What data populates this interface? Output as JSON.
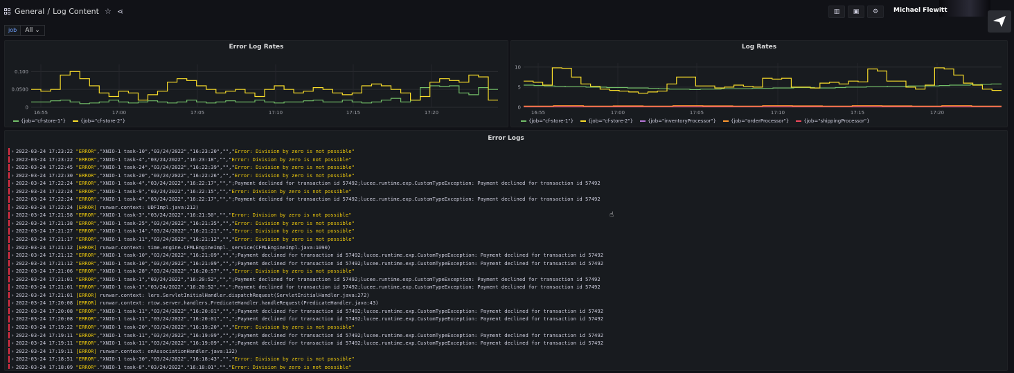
{
  "breadcrumb": {
    "folder": "General",
    "separator": "/",
    "dashboard": "Log Content"
  },
  "user": {
    "name": "Michael Flewitt"
  },
  "variables": [
    {
      "label": "job",
      "value": "All"
    }
  ],
  "colors": {
    "green": "#73bf69",
    "yellow": "#fade2a",
    "purple": "#b877d9",
    "orange": "#ff9830",
    "red": "#f2495c",
    "error_text": "#f2cc0c"
  },
  "panels": {
    "error_rates": {
      "title": "Error Log Rates"
    },
    "log_rates": {
      "title": "Log Rates"
    },
    "error_logs": {
      "title": "Error Logs"
    }
  },
  "chart_data": [
    {
      "type": "line",
      "title": "Error Log Rates",
      "x_ticks": [
        "16:55",
        "17:00",
        "17:05",
        "17:10",
        "17:15",
        "17:20"
      ],
      "y_ticks": [
        "0",
        "0.0500",
        "0.100"
      ],
      "ylim": [
        0,
        0.12
      ],
      "grid": true,
      "legend_position": "bottom-left",
      "series": [
        {
          "name": "{job=\"cf-store-1\"}",
          "color": "#73bf69",
          "values": [
            0.015,
            0.015,
            0.018,
            0.02,
            0.015,
            0.01,
            0.012,
            0.015,
            0.02,
            0.015,
            0.012,
            0.015,
            0.018,
            0.015,
            0.012,
            0.015,
            0.02,
            0.015,
            0.012,
            0.015,
            0.018,
            0.015,
            0.015,
            0.02,
            0.015,
            0.012,
            0.015,
            0.015,
            0.018,
            0.02,
            0.015,
            0.015,
            0.02,
            0.015,
            0.012,
            0.015,
            0.02,
            0.025,
            0.015,
            0.02,
            0.055,
            0.06,
            0.058,
            0.06,
            0.04,
            0.035,
            0.055,
            0.05
          ]
        },
        {
          "name": "{job=\"cf-store-2\"}",
          "color": "#fade2a",
          "values": [
            0.05,
            0.045,
            0.05,
            0.09,
            0.1,
            0.08,
            0.06,
            0.04,
            0.03,
            0.045,
            0.04,
            0.02,
            0.035,
            0.045,
            0.07,
            0.08,
            0.075,
            0.06,
            0.05,
            0.04,
            0.045,
            0.05,
            0.04,
            0.03,
            0.05,
            0.06,
            0.05,
            0.04,
            0.045,
            0.055,
            0.05,
            0.04,
            0.035,
            0.04,
            0.06,
            0.065,
            0.06,
            0.05,
            0.04,
            0.02,
            0.03,
            0.07,
            0.08,
            0.075,
            0.07,
            0.09,
            0.085,
            0.02
          ]
        }
      ]
    },
    {
      "type": "line",
      "title": "Log Rates",
      "x_ticks": [
        "16:55",
        "17:00",
        "17:05",
        "17:10",
        "17:15",
        "17:20"
      ],
      "y_ticks": [
        "0",
        "5",
        "10"
      ],
      "ylim": [
        0,
        11
      ],
      "grid": true,
      "legend_position": "bottom-left",
      "series": [
        {
          "name": "{job=\"cf-store-1\"}",
          "color": "#73bf69",
          "values": [
            5.5,
            5.4,
            5.3,
            5.2,
            5.1,
            5.1,
            5.0,
            5.0,
            4.9,
            4.9,
            4.8,
            4.8,
            4.7,
            4.6,
            4.5,
            4.5,
            4.4,
            4.5,
            4.5,
            4.6,
            4.6,
            4.6,
            4.7,
            4.7,
            4.8,
            4.8,
            4.9,
            4.9,
            4.8,
            4.8,
            4.9,
            5.0,
            5.0,
            5.1,
            5.1,
            5.2,
            5.2,
            5.3,
            5.3,
            5.3,
            5.4,
            5.5,
            5.5,
            5.6,
            5.7,
            5.8
          ]
        },
        {
          "name": "{job=\"cf-store-2\"}",
          "color": "#fade2a",
          "values": [
            6.5,
            6.2,
            5.5,
            9.8,
            9.7,
            7.5,
            5.8,
            5.2,
            4.5,
            4.2,
            4.0,
            3.8,
            3.5,
            3.8,
            4.0,
            5.8,
            7.5,
            7.5,
            5.3,
            5.3,
            4.8,
            5.0,
            5.5,
            5.2,
            5.0,
            7.2,
            7.0,
            7.2,
            5.0,
            5.0,
            4.8,
            6.0,
            6.2,
            5.8,
            6.5,
            6.3,
            9.5,
            9.0,
            6.5,
            6.5,
            5.0,
            4.5,
            5.5,
            9.8,
            9.5,
            8.0,
            6.0,
            5.5,
            4.5,
            4.2
          ]
        },
        {
          "name": "{job=\"inventoryProcessor\"}",
          "color": "#b877d9",
          "values": [
            0.15,
            0.15,
            0.15,
            0.15,
            0.15,
            0.15,
            0.15,
            0.15,
            0.15,
            0.15,
            0.15,
            0.15,
            0.15,
            0.15,
            0.15,
            0.15
          ]
        },
        {
          "name": "{job=\"orderProcessor\"}",
          "color": "#ff9830",
          "values": [
            0.3,
            0.4,
            0.3,
            0.35,
            0.3,
            0.4,
            0.35,
            0.3,
            0.4,
            0.35,
            0.3,
            0.4,
            0.35,
            0.3,
            0.4,
            0.3
          ]
        },
        {
          "name": "{job=\"shippingProcessor\"}",
          "color": "#f2495c",
          "values": [
            0.1,
            0.1,
            0.1,
            0.1,
            0.1,
            0.1,
            0.1,
            0.1,
            0.1,
            0.1,
            0.1,
            0.1,
            0.1,
            0.1,
            0.1,
            0.1
          ]
        }
      ]
    }
  ],
  "logs": [
    {
      "ts": "2022-03-24 17:23:22",
      "lvl": "\"ERROR\"",
      "mid": ",\"XNIO-1 task-10\",\"03/24/2022\",\"16:23:20\",\"\",\"",
      "msg": "Error: Division by zero is not possible\""
    },
    {
      "ts": "2022-03-24 17:23:22",
      "lvl": "\"ERROR\"",
      "mid": ",\"XNIO-1 task-4\",\"03/24/2022\",\"16:23:18\",\"\",\"",
      "msg": "Error: Division by zero is not possible\""
    },
    {
      "ts": "2022-03-24 17:22:45",
      "lvl": "\"ERROR\"",
      "mid": ",\"XNIO-1 task-24\",\"03/24/2022\",\"16:22:39\",\"\",\"",
      "msg": "Error: Division by zero is not possible\""
    },
    {
      "ts": "2022-03-24 17:22:30",
      "lvl": "\"ERROR\"",
      "mid": ",\"XNIO-1 task-20\",\"03/24/2022\",\"16:22:26\",\"\",\"",
      "msg": "Error: Division by zero is not possible\""
    },
    {
      "ts": "2022-03-24 17:22:24",
      "lvl": "\"ERROR\"",
      "mid": ",\"XNIO-1 task-4\",\"03/24/2022\",\"16:22:17\",\"\",\";Payment declined for transaction id 57492;lucee.runtime.exp.CustomTypeException: Payment declined for transaction id 57492",
      "msg": ""
    },
    {
      "ts": "2022-03-24 17:22:24",
      "lvl": "\"ERROR\"",
      "mid": ",\"XNIO-1 task-9\",\"03/24/2022\",\"16:22:15\",\"\",\"",
      "msg": "Error: Division by zero is not possible\""
    },
    {
      "ts": "2022-03-24 17:22:24",
      "lvl": "\"ERROR\"",
      "mid": ",\"XNIO-1 task-4\",\"03/24/2022\",\"16:22:17\",\"\",\";Payment declined for transaction id 57492;lucee.runtime.exp.CustomTypeException: Payment declined for transaction id 57492",
      "msg": ""
    },
    {
      "ts": "2022-03-24 17:22:24",
      "lvl": "[ERROR]",
      "mid": " runwar.context: UDFImpl.java:212)",
      "msg": ""
    },
    {
      "ts": "2022-03-24 17:21:58",
      "lvl": "\"ERROR\"",
      "mid": ",\"XNIO-1 task-3\",\"03/24/2022\",\"16:21:50\",\"\",\"",
      "msg": "Error: Division by zero is not possible\""
    },
    {
      "ts": "2022-03-24 17:21:38",
      "lvl": "\"ERROR\"",
      "mid": ",\"XNIO-1 task-25\",\"03/24/2022\",\"16:21:35\",\"\",\"",
      "msg": "Error: Division by zero is not possible\""
    },
    {
      "ts": "2022-03-24 17:21:27",
      "lvl": "\"ERROR\"",
      "mid": ",\"XNIO-1 task-14\",\"03/24/2022\",\"16:21:21\",\"\",\"",
      "msg": "Error: Division by zero is not possible\""
    },
    {
      "ts": "2022-03-24 17:21:17",
      "lvl": "\"ERROR\"",
      "mid": ",\"XNIO-1 task-11\",\"03/24/2022\",\"16:21:12\",\"\",\"",
      "msg": "Error: Division by zero is not possible\""
    },
    {
      "ts": "2022-03-24 17:21:12",
      "lvl": "[ERROR]",
      "mid": " runwar.context: time.engine.CFMLEngineImpl._service(CFMLEngineImpl.java:1090)",
      "msg": ""
    },
    {
      "ts": "2022-03-24 17:21:12",
      "lvl": "\"ERROR\"",
      "mid": ",\"XNIO-1 task-10\",\"03/24/2022\",\"16:21:09\",\"\",\";Payment declined for transaction id 57492;lucee.runtime.exp.CustomTypeException: Payment declined for transaction id 57492",
      "msg": ""
    },
    {
      "ts": "2022-03-24 17:21:12",
      "lvl": "\"ERROR\"",
      "mid": ",\"XNIO-1 task-10\",\"03/24/2022\",\"16:21:09\",\"\",\";Payment declined for transaction id 57492;lucee.runtime.exp.CustomTypeException: Payment declined for transaction id 57492",
      "msg": ""
    },
    {
      "ts": "2022-03-24 17:21:06",
      "lvl": "\"ERROR\"",
      "mid": ",\"XNIO-1 task-28\",\"03/24/2022\",\"16:20:57\",\"\",\"",
      "msg": "Error: Division by zero is not possible\""
    },
    {
      "ts": "2022-03-24 17:21:01",
      "lvl": "\"ERROR\"",
      "mid": ",\"XNIO-1 task-1\",\"03/24/2022\",\"16:20:52\",\"\",\";Payment declined for transaction id 57492;lucee.runtime.exp.CustomTypeException: Payment declined for transaction id 57492",
      "msg": ""
    },
    {
      "ts": "2022-03-24 17:21:01",
      "lvl": "\"ERROR\"",
      "mid": ",\"XNIO-1 task-1\",\"03/24/2022\",\"16:20:52\",\"\",\";Payment declined for transaction id 57492;lucee.runtime.exp.CustomTypeException: Payment declined for transaction id 57492",
      "msg": ""
    },
    {
      "ts": "2022-03-24 17:21:01",
      "lvl": "[ERROR]",
      "mid": " runwar.context: lers.ServletInitialHandler.dispatchRequest(ServletInitialHandler.java:272)",
      "msg": ""
    },
    {
      "ts": "2022-03-24 17:20:08",
      "lvl": "[ERROR]",
      "mid": " runwar.context: rtow.server.handlers.PredicateHandler.handleRequest(PredicateHandler.java:43)",
      "msg": ""
    },
    {
      "ts": "2022-03-24 17:20:08",
      "lvl": "\"ERROR\"",
      "mid": ",\"XNIO-1 task-11\",\"03/24/2022\",\"16:20:01\",\"\",\";Payment declined for transaction id 57492;lucee.runtime.exp.CustomTypeException: Payment declined for transaction id 57492",
      "msg": ""
    },
    {
      "ts": "2022-03-24 17:20:08",
      "lvl": "\"ERROR\"",
      "mid": ",\"XNIO-1 task-11\",\"03/24/2022\",\"16:20:01\",\"\",\";Payment declined for transaction id 57492;lucee.runtime.exp.CustomTypeException: Payment declined for transaction id 57492",
      "msg": ""
    },
    {
      "ts": "2022-03-24 17:19:22",
      "lvl": "\"ERROR\"",
      "mid": ",\"XNIO-1 task-20\",\"03/24/2022\",\"16:19:20\",\"\",\"",
      "msg": "Error: Division by zero is not possible\""
    },
    {
      "ts": "2022-03-24 17:19:11",
      "lvl": "\"ERROR\"",
      "mid": ",\"XNIO-1 task-11\",\"03/24/2022\",\"16:19:09\",\"\",\";Payment declined for transaction id 57492;lucee.runtime.exp.CustomTypeException: Payment declined for transaction id 57492",
      "msg": ""
    },
    {
      "ts": "2022-03-24 17:19:11",
      "lvl": "\"ERROR\"",
      "mid": ",\"XNIO-1 task-11\",\"03/24/2022\",\"16:19:09\",\"\",\";Payment declined for transaction id 57492;lucee.runtime.exp.CustomTypeException: Payment declined for transaction id 57492",
      "msg": ""
    },
    {
      "ts": "2022-03-24 17:19:11",
      "lvl": "[ERROR]",
      "mid": " runwar.context: onAssociationHandler.java:132)",
      "msg": ""
    },
    {
      "ts": "2022-03-24 17:18:51",
      "lvl": "\"ERROR\"",
      "mid": ",\"XNIO-1 task-30\",\"03/24/2022\",\"16:18:43\",\"\",\"",
      "msg": "Error: Division by zero is not possible\""
    },
    {
      "ts": "2022-03-24 17:18:09",
      "lvl": "\"ERROR\"",
      "mid": ",\"XNIO-1 task-8\",\"03/24/2022\",\"16:18:01\",\"\",\"",
      "msg": "Error: Division by zero is not possible\""
    }
  ]
}
